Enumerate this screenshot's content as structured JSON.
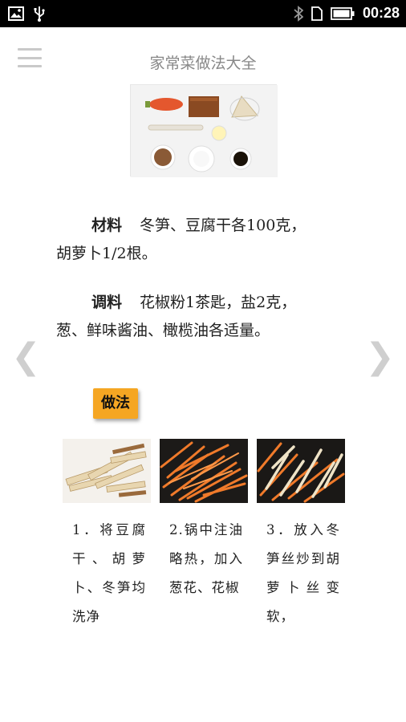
{
  "status_bar": {
    "time": "00:28",
    "icons": [
      "image-icon",
      "usb-icon",
      "bluetooth-icon",
      "sim-icon",
      "battery-icon"
    ]
  },
  "header": {
    "title": "家常菜做法大全",
    "menu_icon": "menu-icon"
  },
  "recipe": {
    "ingredients_label": "材料",
    "ingredients_text": "冬笋、豆腐干各100克，胡萝卜1/2根。",
    "seasoning_label": "调料",
    "seasoning_text": "花椒粉1茶匙，盐2克，葱、鲜味酱油、橄榄油各适量。",
    "method_label": "做法",
    "steps": [
      {
        "text": "1．将豆腐干、胡萝卜、冬笋均洗净"
      },
      {
        "text": "2.锅中注油略热，加入葱花、花椒"
      },
      {
        "text": "3．放入冬笋丝炒到胡萝卜丝变软，"
      }
    ]
  },
  "navigation": {
    "prev_glyph": "❮",
    "next_glyph": "❯"
  },
  "colors": {
    "method_badge": "#f5a623",
    "title_text": "#888888",
    "status_bar": "#000000"
  }
}
